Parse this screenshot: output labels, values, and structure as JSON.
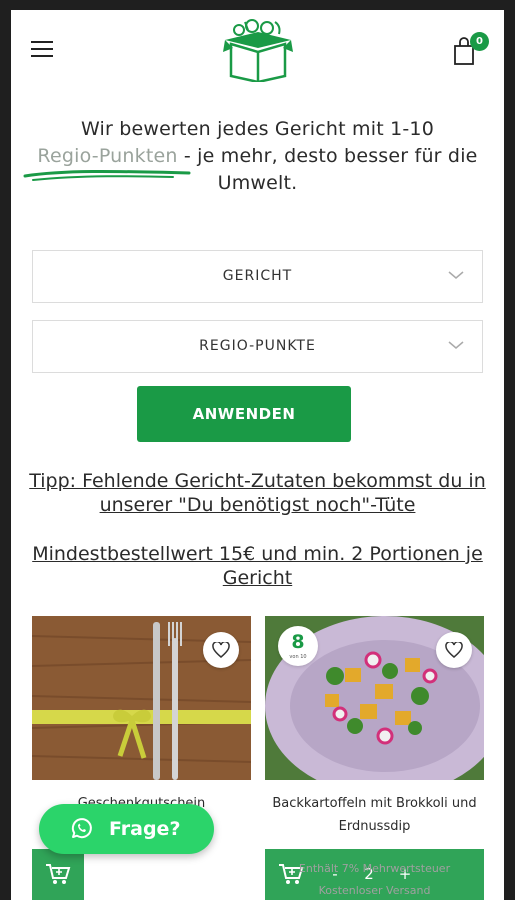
{
  "header": {
    "cart_count": "0"
  },
  "intro": {
    "line1": "Wir bewerten jedes Gericht mit 1-10",
    "highlight": "Regio-Punkten",
    "line2_rest": " - je mehr, desto besser für die",
    "line3": "Umwelt."
  },
  "filters": {
    "dish_label": "GERICHT",
    "points_label": "REGIO-PUNKTE",
    "apply_label": "ANWENDEN"
  },
  "links": {
    "tip": "Tipp: Fehlende Gericht-Zutaten bekommst du in unserer \"Du benötigst noch\"-Tüte",
    "minimum": "Mindestbestellwert 15€ und min. 2 Portionen je Gericht"
  },
  "products": [
    {
      "title": "Geschenkgutschein",
      "tax": ""
    },
    {
      "score": "8",
      "score_sub": "von 10",
      "title": "Backkartoffeln mit Brokkoli und Erdnussdip",
      "qty_minus": "-",
      "qty": "2",
      "qty_plus": "+",
      "tax": "Enthält 7% Mehrwertsteuer",
      "shipping": "Kostenloser Versand"
    }
  ],
  "chat": {
    "label": "Frage?"
  },
  "colors": {
    "brand_green": "#1a9a46",
    "whatsapp_green": "#2bd46a"
  }
}
